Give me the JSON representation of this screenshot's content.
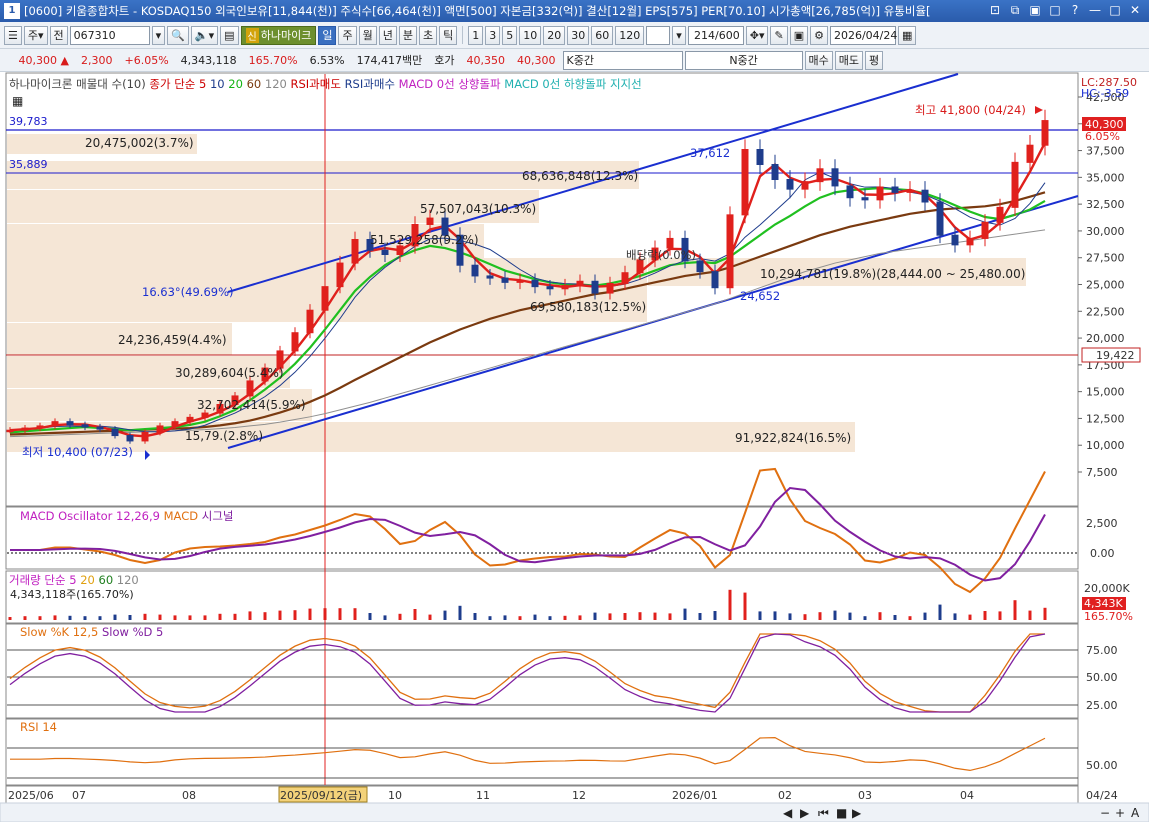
{
  "titlebar": {
    "screen_no": "1",
    "text": "[0600] 키움종합차트 - KOSDAQ150 외국인보유[11,844(천)] 주식수[66,464(천)] 액면[500] 자본금[332(억)] 결산[12월] EPS[575] PER[70.10] 시가총액[26,785(억)] 유통비율[",
    "buttons": [
      "⊡",
      "⧉",
      "▣",
      "□",
      "?",
      "—",
      "□",
      "✕"
    ]
  },
  "toolbar1": {
    "period": "주",
    "all": "전",
    "code": "067310",
    "stock_badge": "신",
    "stock_name": "하나마이크",
    "intervals": [
      "일",
      "주",
      "월",
      "년",
      "분",
      "초",
      "틱"
    ],
    "selected_interval": "일",
    "minute_options": [
      "1",
      "3",
      "5",
      "10",
      "20",
      "30",
      "60",
      "120"
    ],
    "count": "214",
    "count_total": "/600",
    "date": "2026/04/24"
  },
  "toolbar2": {
    "price": "40,300",
    "change_arrow": "▲",
    "change": "2,300",
    "change_pct": "+6.05%",
    "volume": "4,343,118",
    "volume_pct": "165.70%",
    "turnover": "6.53%",
    "amount": "174,417백만",
    "quote_label": "호가",
    "ask": "40,350",
    "bid": "40,300",
    "k_label": "K중간",
    "n_label": "N중간",
    "buy": "매수",
    "sell": "매도",
    "eval": "평"
  },
  "main_legend": {
    "items": [
      {
        "text": "하나마이크론 매물대 수(10)",
        "color": "#444444"
      },
      {
        "text": "종가 단순 5",
        "color": "#cc0000"
      },
      {
        "text": "10",
        "color": "#1e3c8c"
      },
      {
        "text": "20",
        "color": "#14b414"
      },
      {
        "text": "60",
        "color": "#7a3a10"
      },
      {
        "text": "120",
        "color": "#888888"
      },
      {
        "text": "RSI과매도",
        "color": "#cc0000"
      },
      {
        "text": "RSI과매수",
        "color": "#1e3c8c"
      },
      {
        "text": "MACD 0선 상향돌파",
        "color": "#c020c0"
      },
      {
        "text": "MACD 0선 하향돌파",
        "color": "#20b0b0"
      },
      {
        "text": "지지선",
        "color": "#20b0b0"
      }
    ],
    "lc": "LC:287.50",
    "hc": "HC:-3.59"
  },
  "price_axis": {
    "ticks": [
      "42,500",
      "40,000",
      "37,500",
      "35,000",
      "32,500",
      "30,000",
      "27,500",
      "25,000",
      "22,500",
      "20,000",
      "17,500",
      "15,000",
      "12,500",
      "10,000",
      "7,500"
    ],
    "current_label": "40,300",
    "current_pct": "6.05%",
    "level_label": "19,422"
  },
  "volume_profile": [
    {
      "label": "20,475,002(3.7%)"
    },
    {
      "label": "68,636,848(12.3%)"
    },
    {
      "label": "57,507,043(10.3%)"
    },
    {
      "label": "51,529,258(9.2%)"
    },
    {
      "label": "69,580,183(12.5%)"
    },
    {
      "label": "24,236,459(4.4%)"
    },
    {
      "label": "30,289,604(5.4%)"
    },
    {
      "label": "32,702,414(5.9%)"
    },
    {
      "label": "15,79.(2.8%)"
    },
    {
      "label": "91,922,824(16.5%)"
    },
    {
      "label": "10,294,781(19.8%)(28,444.00 ~ 25,480.00)"
    }
  ],
  "annotations": {
    "line_39783": "39,783",
    "line_35889": "35,889",
    "high": "최고 41,800 (04/24)",
    "low": "최저 10,400 (07/23)",
    "trend_label": "16.63°(49.69%)",
    "point_37612": "37,612",
    "point_24652": "24,652",
    "dividend": "배당락(0.0%)"
  },
  "chart_data": {
    "type": "candlestick",
    "title": "하나마이크론",
    "x_axis": {
      "ticks": [
        "2025/06",
        "07",
        "08",
        "2025/09/12(금)",
        "10",
        "11",
        "12",
        "2026/01",
        "02",
        "03",
        "04",
        "04/24"
      ]
    },
    "y_axis": {
      "ylim": [
        7500,
        42500
      ]
    },
    "close_series": [
      11400,
      11600,
      11800,
      12200,
      11900,
      11700,
      11500,
      10900,
      10400,
      11200,
      11800,
      12200,
      12600,
      13000,
      13800,
      14600,
      16000,
      17200,
      18800,
      20500,
      22600,
      24800,
      27000,
      29200,
      28200,
      27800,
      28600,
      30600,
      31200,
      29600,
      26800,
      25800,
      25600,
      25200,
      25400,
      24800,
      24600,
      24900,
      25300,
      24200,
      25100,
      26100,
      27300,
      28400,
      29300,
      27200,
      26200,
      24700,
      31500,
      37600,
      36200,
      34800,
      33900,
      34600,
      35800,
      34200,
      33100,
      32900,
      34100,
      33600,
      33800,
      32700,
      29600,
      28700,
      29300,
      30800,
      32200,
      36400,
      38000,
      40300
    ],
    "sma20": [
      11200,
      11300,
      11400,
      11500,
      11600,
      11700,
      11600,
      11500,
      11400,
      11500,
      11600,
      11700,
      11900,
      12200,
      12700,
      13300,
      14200,
      15200,
      16300,
      17600,
      19100,
      20800,
      22600,
      24400,
      25700,
      26800,
      27600,
      28200,
      28600,
      28400,
      28000,
      27500,
      26900,
      26300,
      25900,
      25500,
      25200,
      25000,
      25000,
      24900,
      25100,
      25400,
      25800,
      26300,
      26800,
      27000,
      27100,
      27000,
      27600,
      28600,
      29600,
      30600,
      31400,
      32300,
      33100,
      33600,
      33800,
      33900,
      34000,
      33900,
      33800,
      33500,
      33000,
      32400,
      31800,
      31300,
      31100,
      31500,
      32000,
      32800
    ],
    "sma60": [
      11000,
      11050,
      11100,
      11150,
      11200,
      11250,
      11300,
      11350,
      11400,
      11450,
      11500,
      11550,
      11600,
      11700,
      11850,
      12050,
      12300,
      12650,
      13050,
      13500,
      14050,
      14650,
      15350,
      16100,
      16800,
      17500,
      18200,
      18900,
      19600,
      20200,
      20800,
      21300,
      21800,
      22200,
      22600,
      22900,
      23200,
      23500,
      23800,
      24100,
      24300,
      24600,
      24900,
      25200,
      25500,
      25800,
      26000,
      26200,
      26600,
      27100,
      27600,
      28100,
      28600,
      29100,
      29600,
      30000,
      30400,
      30700,
      31000,
      31300,
      31600,
      31800,
      32000,
      32100,
      32200,
      32300,
      32500,
      32800,
      33200,
      33600
    ],
    "sma120": [
      10800,
      10850,
      10900,
      10950,
      11000,
      11050,
      11100,
      11150,
      11200,
      11250,
      11300,
      11350,
      11400,
      11450,
      11550,
      11650,
      11800,
      11950,
      12150,
      12400,
      12650,
      12950,
      13300,
      13650,
      14000,
      14400,
      14800,
      15200,
      15600,
      16000,
      16400,
      16800,
      17200,
      17600,
      18000,
      18400,
      18800,
      19200,
      19600,
      20000,
      20400,
      20800,
      21200,
      21600,
      22000,
      22400,
      22800,
      23200,
      23700,
      24200,
      24700,
      25200,
      25700,
      26200,
      26600,
      27000,
      27300,
      27600,
      27900,
      28100,
      28300,
      28500,
      28700,
      28900,
      29100,
      29300,
      29500,
      29700,
      29900,
      30100
    ],
    "high": 41800,
    "low": 10400,
    "current": 40300
  },
  "subcharts": {
    "macd": {
      "label": "MACD Oscillator 12,26,9",
      "label2": "MACD",
      "label3": "시그널",
      "ticks": [
        "2,500",
        "0.00"
      ]
    },
    "volume": {
      "label": "거래량",
      "sma_label": "단순 5",
      "p20": "20",
      "p60": "60",
      "p120": "120",
      "value": "4,343,118주(165.70%)",
      "tick": "20,000K",
      "current": "4,343K",
      "pct": "165.70%"
    },
    "slow": {
      "label": "Slow %K 12,5",
      "label2": "Slow %D 5",
      "ticks": [
        "75.00",
        "50.00",
        "25.00"
      ]
    },
    "rsi": {
      "label": "RSI 14",
      "ticks": [
        "50.00"
      ]
    }
  },
  "colors": {
    "up": "#e0201c",
    "down": "#1e3c8c",
    "sma5": "#e0201c",
    "sma20": "#20c020",
    "sma60": "#7a3a10",
    "sma120": "#909090",
    "trend": "#1a2fd0",
    "profile": "#f5e6d6"
  }
}
